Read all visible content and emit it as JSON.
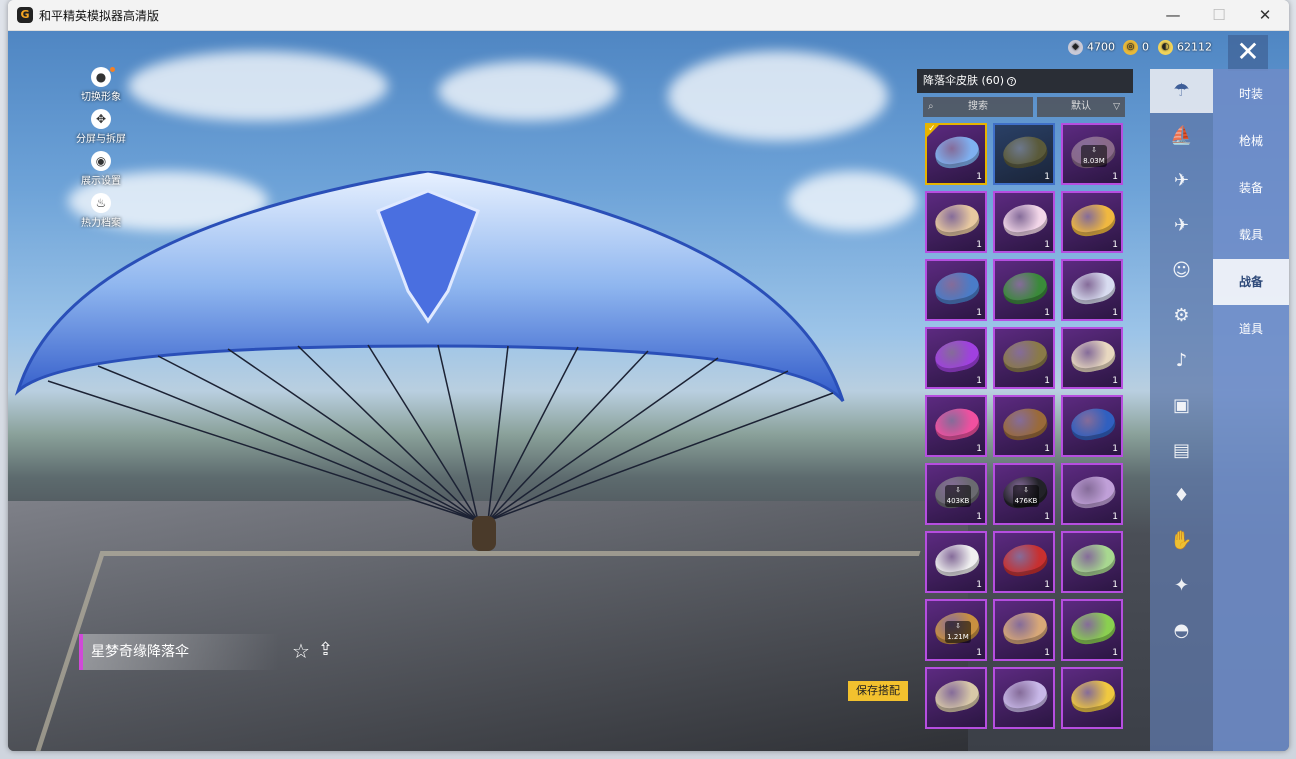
{
  "window": {
    "title": "和平精英模拟器高清版",
    "min": "—",
    "max": "☐",
    "close": "✕",
    "app_icon": "G"
  },
  "left_menu": [
    {
      "label": "切换形象",
      "icon": "person-icon"
    },
    {
      "label": "分屏与拆屏",
      "icon": "split-icon"
    },
    {
      "label": "展示设置",
      "icon": "eye-icon"
    },
    {
      "label": "热力档案",
      "icon": "flame-icon"
    }
  ],
  "currency": [
    {
      "value": "4700",
      "icon": "coin-silver-icon",
      "color": "#c9c9d6"
    },
    {
      "value": "0",
      "icon": "coin-gold-icon",
      "color": "#e8b93a"
    },
    {
      "value": "62112",
      "icon": "coin-yellow-icon",
      "color": "#f1d35a"
    }
  ],
  "close_button": "✕",
  "panel": {
    "title": "降落伞皮肤 (60)",
    "info_icon": "?",
    "search_placeholder": "搜索",
    "sort_value": "默认"
  },
  "grid": {
    "items": [
      {
        "count": "1",
        "color": "#7fb0f0",
        "border": "sel",
        "download": ""
      },
      {
        "count": "1",
        "color": "#5a5a3a",
        "border": "blue",
        "download": ""
      },
      {
        "count": "1",
        "color": "#8a6a8a",
        "border": "",
        "download": "8.03M"
      },
      {
        "count": "1",
        "color": "#e8c9a0",
        "border": "",
        "download": ""
      },
      {
        "count": "1",
        "color": "#f2d6e8",
        "border": "",
        "download": ""
      },
      {
        "count": "1",
        "color": "#f0b840",
        "border": "",
        "download": ""
      },
      {
        "count": "1",
        "color": "#4a7cc8",
        "border": "",
        "download": ""
      },
      {
        "count": "1",
        "color": "#3a8a3a",
        "border": "",
        "download": ""
      },
      {
        "count": "1",
        "color": "#d8dcf0",
        "border": "",
        "download": ""
      },
      {
        "count": "1",
        "color": "#a040e0",
        "border": "",
        "download": ""
      },
      {
        "count": "1",
        "color": "#8a7a48",
        "border": "",
        "download": ""
      },
      {
        "count": "1",
        "color": "#e8d8c0",
        "border": "",
        "download": ""
      },
      {
        "count": "1",
        "color": "#f050a0",
        "border": "",
        "download": ""
      },
      {
        "count": "1",
        "color": "#9a6a3a",
        "border": "",
        "download": ""
      },
      {
        "count": "1",
        "color": "#3060c0",
        "border": "",
        "download": ""
      },
      {
        "count": "1",
        "color": "#6a6a70",
        "border": "",
        "download": "403KB"
      },
      {
        "count": "1",
        "color": "#222228",
        "border": "",
        "download": "476KB"
      },
      {
        "count": "1",
        "color": "#c0a0d8",
        "border": "",
        "download": ""
      },
      {
        "count": "1",
        "color": "#f0f0f0",
        "border": "",
        "download": ""
      },
      {
        "count": "1",
        "color": "#c83030",
        "border": "",
        "download": ""
      },
      {
        "count": "1",
        "color": "#a8d890",
        "border": "",
        "download": ""
      },
      {
        "count": "1",
        "color": "#c89040",
        "border": "",
        "download": "1.21M"
      },
      {
        "count": "1",
        "color": "#d8a878",
        "border": "",
        "download": ""
      },
      {
        "count": "1",
        "color": "#8ad050",
        "border": "",
        "download": ""
      },
      {
        "count": "",
        "color": "#d8c8a8",
        "border": "",
        "download": ""
      },
      {
        "count": "",
        "color": "#c8b8e8",
        "border": "",
        "download": ""
      },
      {
        "count": "",
        "color": "#f0c840",
        "border": "",
        "download": ""
      }
    ]
  },
  "category_icons": [
    {
      "icon": "parachute-icon",
      "active": true
    },
    {
      "icon": "boat-icon",
      "active": false
    },
    {
      "icon": "drone-icon",
      "active": false
    },
    {
      "icon": "plane-icon",
      "active": false
    },
    {
      "icon": "smiley-icon",
      "active": false
    },
    {
      "icon": "robot-icon",
      "active": false
    },
    {
      "icon": "speaker-icon",
      "active": false
    },
    {
      "icon": "badge-icon",
      "active": false
    },
    {
      "icon": "picture-icon",
      "active": false
    },
    {
      "icon": "extinguisher-icon",
      "active": false
    },
    {
      "icon": "hand-icon",
      "active": false
    },
    {
      "icon": "wand-icon",
      "active": false
    },
    {
      "icon": "helmet-icon",
      "active": false
    }
  ],
  "categories": [
    {
      "label": "时装",
      "active": false
    },
    {
      "label": "枪械",
      "active": false
    },
    {
      "label": "装备",
      "active": false
    },
    {
      "label": "载具",
      "active": false
    },
    {
      "label": "战备",
      "active": true
    },
    {
      "label": "道具",
      "active": false
    }
  ],
  "item_name": "星梦奇缘降落伞",
  "save_button": "保存搭配"
}
